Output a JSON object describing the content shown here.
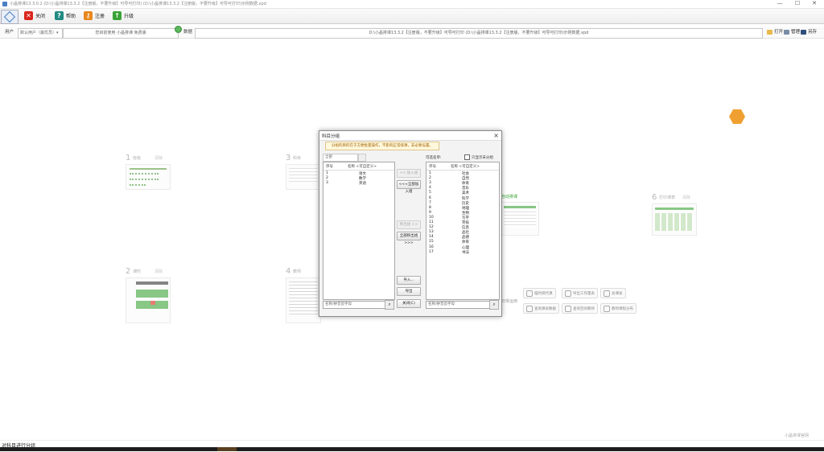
{
  "window": {
    "title": "小晶排课13.3.0.2  (D:\\小晶排课13.3.2【注册版，不要升级】可导可打印) (D:\\小晶排课13.3.2【注册版，不要升级】可导可打印)示例数据.xpd",
    "minimize": "—",
    "maximize": "☐",
    "close": "✕"
  },
  "toolbar": {
    "items": [
      {
        "label": "关闭",
        "icon": "close-icon",
        "color": "#d9261c",
        "glyph": "✕"
      },
      {
        "label": "帮助",
        "icon": "help-icon",
        "color": "#1f8a83",
        "glyph": "?"
      },
      {
        "label": "注册",
        "icon": "key-icon",
        "color": "#e8871e",
        "glyph": "⚷"
      },
      {
        "label": "升级",
        "icon": "upgrade-icon",
        "color": "#3aa335",
        "glyph": "↑"
      }
    ]
  },
  "row2": {
    "user_label": "用户",
    "user_value": "默认用户（最优员）▾",
    "license_text": "您目前使用 小晶排课 免费版",
    "data_label": "数据",
    "data_path": "D:\\小晶排课13.3.2【注册版，不要升级】可导可打印 (D:\\小晶排课13.3.2【注册版，不要升级】可导可打印)示例数据.xpd",
    "open": "打开",
    "manage": "管理",
    "save_as": "另存"
  },
  "cards": [
    {
      "num": "1",
      "name": "班级"
    },
    {
      "num": "2",
      "name": "课时"
    },
    {
      "num": "3",
      "name": "科目"
    },
    {
      "num": "4",
      "name": "教师"
    },
    {
      "num": "6",
      "name": "打印课表"
    }
  ],
  "card_actions": {
    "clear": "清除"
  },
  "auto_arrange": "自动排课",
  "dialog": {
    "title": "科目分组",
    "close": "×",
    "hint": "分组的目的在于方便批量操作，不影响正常排课，非必要设置。",
    "group_select": "全部",
    "left_header": [
      "序号",
      "名称 <可自定义>"
    ],
    "left_rows": [
      {
        "no": "1",
        "name": "语文"
      },
      {
        "no": "2",
        "name": "数学"
      },
      {
        "no": "3",
        "name": "英语"
      }
    ],
    "right_label": "可选名单:",
    "show_unassigned": "只显示未分组",
    "right_header": [
      "序号",
      "名称 <可自定义>"
    ],
    "right_rows": [
      {
        "no": "1",
        "name": "社会"
      },
      {
        "no": "2",
        "name": "自然"
      },
      {
        "no": "3",
        "name": "体育"
      },
      {
        "no": "4",
        "name": "音乐"
      },
      {
        "no": "5",
        "name": "美术"
      },
      {
        "no": "6",
        "name": "科学"
      },
      {
        "no": "7",
        "name": "历史"
      },
      {
        "no": "8",
        "name": "地理"
      },
      {
        "no": "9",
        "name": "生物"
      },
      {
        "no": "10",
        "name": "写字"
      },
      {
        "no": "11",
        "name": "劳技"
      },
      {
        "no": "12",
        "name": "信息"
      },
      {
        "no": "13",
        "name": "品社"
      },
      {
        "no": "14",
        "name": "品德"
      },
      {
        "no": "15",
        "name": "体育"
      },
      {
        "no": "16",
        "name": "心理"
      },
      {
        "no": "17",
        "name": "书法"
      }
    ],
    "btn_add": "<< 加入组",
    "btn_add_all": "<<<全部加入组",
    "btn_remove": "移出组 >>",
    "btn_remove_all": "全部移出组>>>",
    "btn_import": "导入...",
    "btn_export": "导出",
    "btn_close": "关闭(C)",
    "search_placeholder": "名称/拼音首字母"
  },
  "workflow": {
    "label": "日常运用",
    "buttons": [
      "临时调代课",
      "导出工作量表",
      "总课表",
      "查询课表数据",
      "查询空闲教师",
      "教师课程分布"
    ]
  },
  "footer_brand": "小晶排课官网",
  "status_text": "对科目进行分组"
}
